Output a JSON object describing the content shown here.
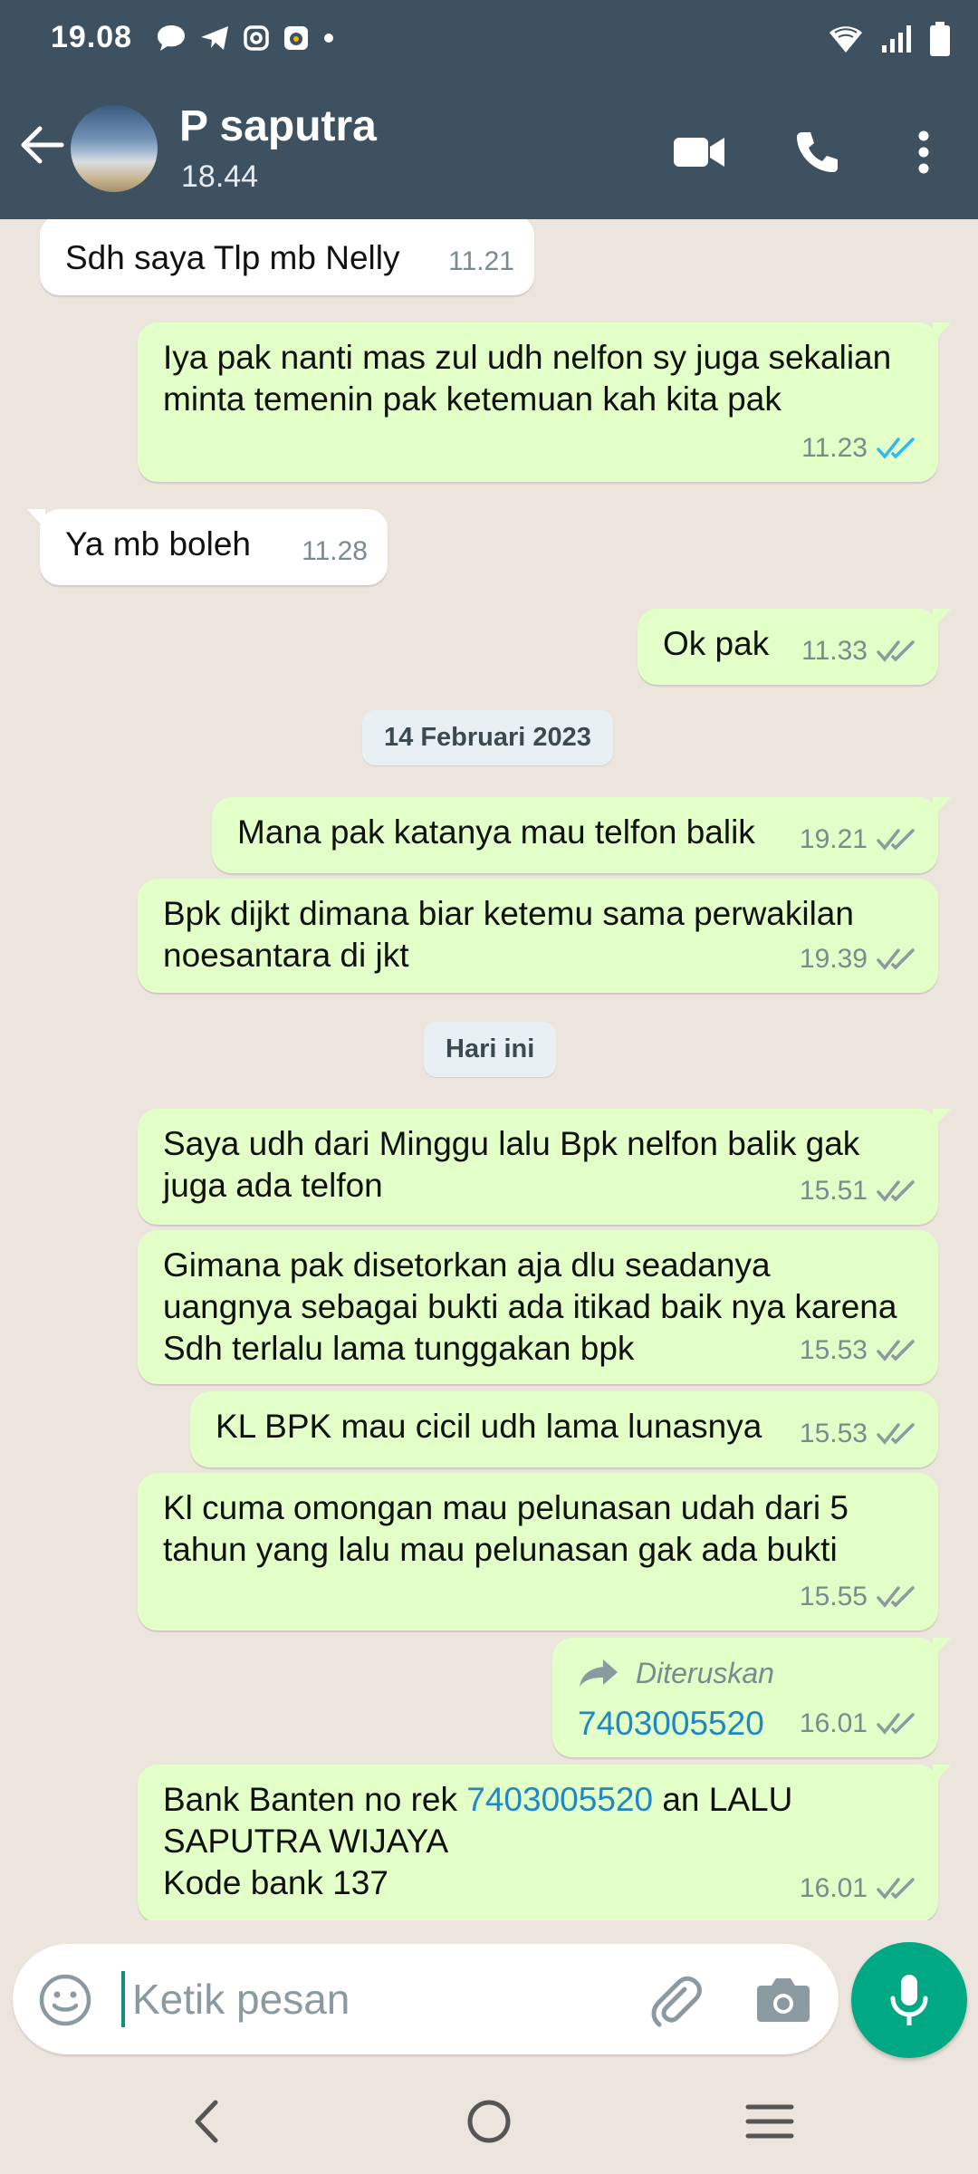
{
  "status_bar": {
    "time": "19.08"
  },
  "header": {
    "contact_name": "P saputra",
    "subtitle": "18.44"
  },
  "messages": [
    {
      "text": "Sdh saya Tlp mb Nelly",
      "time": "11.21"
    },
    {
      "text": "Iya pak nanti mas zul udh nelfon sy juga sekalian minta temenin pak ketemuan kah kita pak",
      "time": "11.23"
    },
    {
      "text": "Ya mb boleh",
      "time": "11.28"
    },
    {
      "text": "Ok pak",
      "time": "11.33"
    },
    {
      "text": "Mana pak katanya mau telfon balik",
      "time": "19.21"
    },
    {
      "text": "Bpk dijkt dimana biar ketemu sama perwakilan noesantara di jkt",
      "time": "19.39"
    },
    {
      "text": "Saya udh dari Minggu lalu Bpk nelfon balik gak juga ada telfon",
      "time": "15.51"
    },
    {
      "text": "Gimana pak disetorkan aja dlu seadanya uangnya sebagai bukti ada itikad baik nya karena Sdh terlalu lama tunggakan bpk",
      "time": "15.53"
    },
    {
      "text": "KL BPK mau cicil udh lama lunasnya",
      "time": "15.53"
    },
    {
      "text": "Kl cuma omongan mau pelunasan udah dari 5 tahun yang lalu mau pelunasan gak ada bukti",
      "time": "15.55"
    },
    {
      "forwarded_label": "Diteruskan",
      "text": "7403005520",
      "time": "16.01"
    },
    {
      "text_before": "Bank Banten no rek ",
      "link": "7403005520",
      "text_after_line1": " an LALU",
      "text_line2": "SAPUTRA WIJAYA",
      "text_line3": "Kode bank 137",
      "time": "16.01"
    }
  ],
  "date_chips": {
    "feb": "14 Februari 2023",
    "today": "Hari ini"
  },
  "input": {
    "placeholder": "Ketik pesan"
  },
  "colors": {
    "header": "#3e5160",
    "outgoing": "#e1ffc7",
    "incoming": "#ffffff",
    "read_tick": "#34b7f1",
    "mic": "#00a884"
  }
}
